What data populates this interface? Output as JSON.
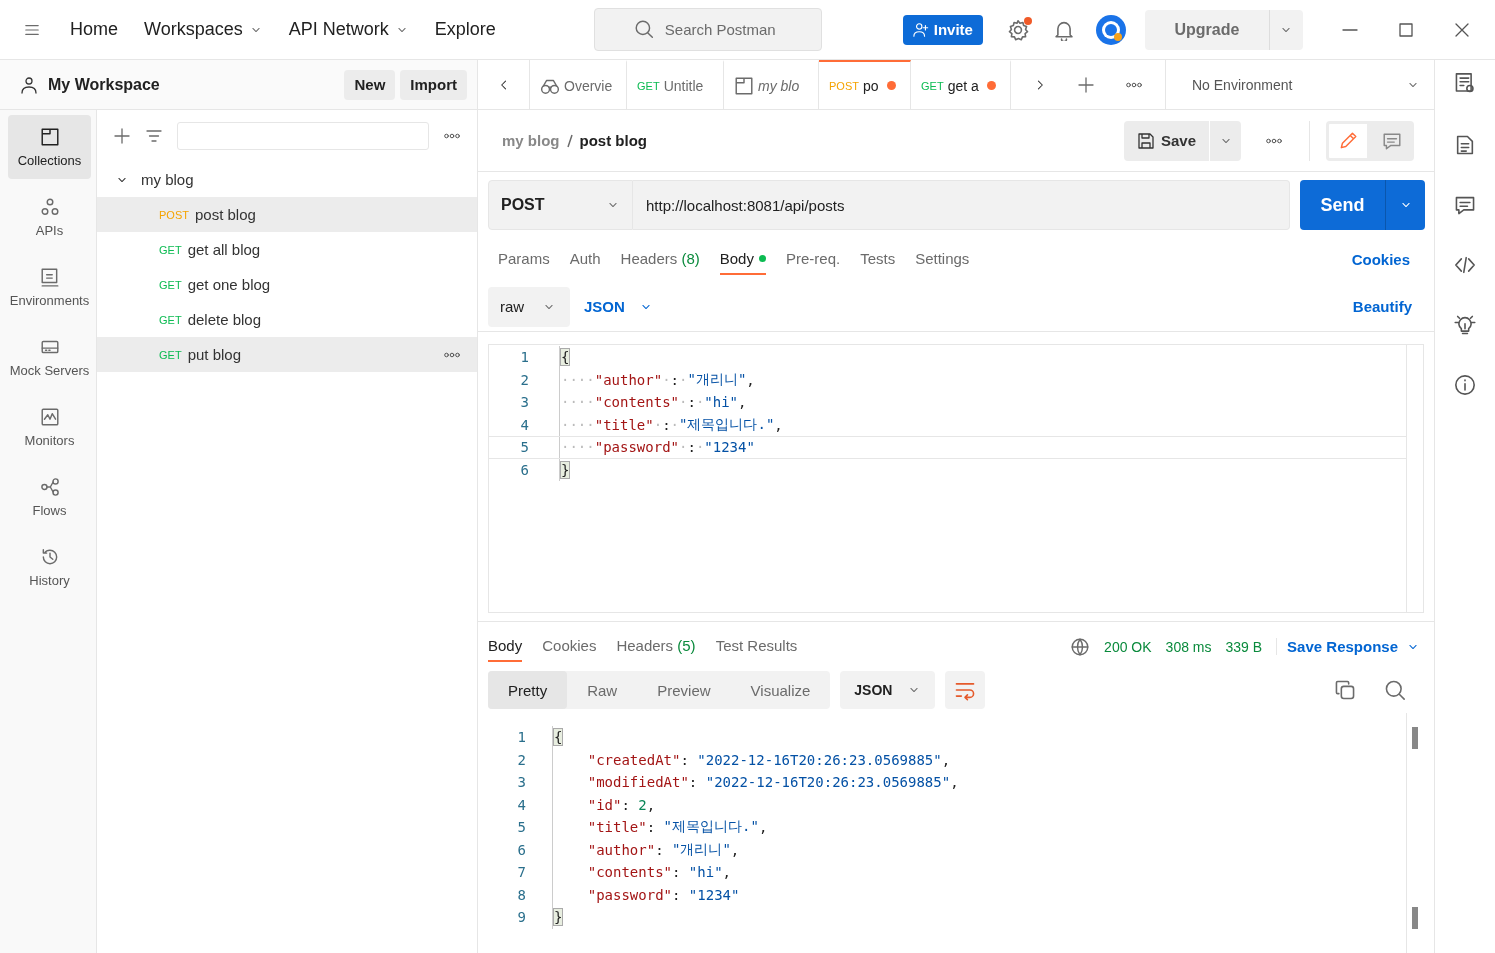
{
  "top_nav": {
    "items": [
      {
        "label": "Home",
        "caret": false
      },
      {
        "label": "Workspaces",
        "caret": true
      },
      {
        "label": "API Network",
        "caret": true
      },
      {
        "label": "Explore",
        "caret": false
      }
    ],
    "search": {
      "placeholder": "Search Postman"
    },
    "invite": "Invite",
    "settings_badge": true,
    "upgrade": "Upgrade"
  },
  "workspace": {
    "title": "My Workspace",
    "buttons": [
      "New",
      "Import"
    ]
  },
  "rail": [
    {
      "label": "Collections",
      "selected": true
    },
    {
      "label": "APIs",
      "selected": false
    },
    {
      "label": "Environments",
      "selected": false
    },
    {
      "label": "Mock Servers",
      "selected": false
    },
    {
      "label": "Monitors",
      "selected": false
    },
    {
      "label": "Flows",
      "selected": false
    },
    {
      "label": "History",
      "selected": false
    }
  ],
  "tree": {
    "name": "my blog",
    "expanded": true,
    "children": [
      {
        "method": "POST",
        "name": "post blog",
        "selected": true,
        "hovered": false
      },
      {
        "method": "GET",
        "name": "get all blog",
        "selected": false,
        "hovered": false
      },
      {
        "method": "GET",
        "name": "get one blog",
        "selected": false,
        "hovered": false
      },
      {
        "method": "GET",
        "name": "delete blog",
        "selected": false,
        "hovered": false
      },
      {
        "method": "GET",
        "name": "put blog",
        "selected": false,
        "hovered": true
      }
    ]
  },
  "tabs": [
    {
      "kind": "overview",
      "title": "Overvie",
      "selected": false,
      "unsaved": false
    },
    {
      "kind": "request",
      "method": "GET",
      "title": "Untitle",
      "selected": false,
      "unsaved": false
    },
    {
      "kind": "collection",
      "title": "my blo",
      "selected": false,
      "unsaved": false
    },
    {
      "kind": "request",
      "method": "POST",
      "title": "po",
      "selected": true,
      "unsaved": true
    },
    {
      "kind": "request",
      "method": "GET",
      "title": "get a",
      "selected": false,
      "unsaved": true
    }
  ],
  "environment": "No Environment",
  "breadcrumb": {
    "parent": "my blog",
    "current": "post blog",
    "save": "Save"
  },
  "request": {
    "method": "POST",
    "url": "http://localhost:8081/api/posts",
    "send": "Send"
  },
  "request_tabs": [
    {
      "label": "Params",
      "selected": false,
      "dot": false
    },
    {
      "label": "Auth",
      "selected": false,
      "dot": false
    },
    {
      "label": "Headers",
      "count": "(8)",
      "selected": false,
      "dot": false
    },
    {
      "label": "Body",
      "selected": true,
      "dot": true
    },
    {
      "label": "Pre-req.",
      "selected": false,
      "dot": false
    },
    {
      "label": "Tests",
      "selected": false,
      "dot": false
    },
    {
      "label": "Settings",
      "selected": false,
      "dot": false
    }
  ],
  "cookies_link": "Cookies",
  "body_options": {
    "mode": "raw",
    "format": "JSON",
    "beautify": "Beautify"
  },
  "request_body": [
    {
      "number": "1",
      "tokens": [
        {
          "kind": "bracket",
          "text": "{"
        }
      ]
    },
    {
      "number": "2",
      "tokens": [
        {
          "kind": "ws",
          "text": "····"
        },
        {
          "kind": "key",
          "text": "\"author\""
        },
        {
          "kind": "ws",
          "text": "·"
        },
        {
          "kind": "punct",
          "text": ":"
        },
        {
          "kind": "ws",
          "text": "·"
        },
        {
          "kind": "string",
          "text": "\"개리니\""
        },
        {
          "kind": "punct",
          "text": ","
        }
      ]
    },
    {
      "number": "3",
      "tokens": [
        {
          "kind": "ws",
          "text": "····"
        },
        {
          "kind": "key",
          "text": "\"contents\""
        },
        {
          "kind": "ws",
          "text": "·"
        },
        {
          "kind": "punct",
          "text": ":"
        },
        {
          "kind": "ws",
          "text": "·"
        },
        {
          "kind": "string",
          "text": "\"hi\""
        },
        {
          "kind": "punct",
          "text": ","
        }
      ]
    },
    {
      "number": "4",
      "tokens": [
        {
          "kind": "ws",
          "text": "····"
        },
        {
          "kind": "key",
          "text": "\"title\""
        },
        {
          "kind": "ws",
          "text": "·"
        },
        {
          "kind": "punct",
          "text": ":"
        },
        {
          "kind": "ws",
          "text": "·"
        },
        {
          "kind": "string",
          "text": "\"제목입니다.\""
        },
        {
          "kind": "punct",
          "text": ","
        }
      ]
    },
    {
      "number": "5",
      "current": true,
      "tokens": [
        {
          "kind": "ws",
          "text": "····"
        },
        {
          "kind": "key",
          "text": "\"password\""
        },
        {
          "kind": "ws",
          "text": "·"
        },
        {
          "kind": "punct",
          "text": ":"
        },
        {
          "kind": "ws",
          "text": "·"
        },
        {
          "kind": "string",
          "text": "\"1234\""
        }
      ]
    },
    {
      "number": "6",
      "tokens": [
        {
          "kind": "bracket",
          "text": "}"
        }
      ]
    }
  ],
  "response_tabs": [
    {
      "label": "Body",
      "selected": true
    },
    {
      "label": "Cookies",
      "selected": false
    },
    {
      "label": "Headers",
      "count": "(5)",
      "selected": false
    },
    {
      "label": "Test Results",
      "selected": false
    }
  ],
  "response_status": {
    "status": "200 OK",
    "time": "308 ms",
    "size": "339 B",
    "save": "Save Response"
  },
  "view_modes": [
    {
      "label": "Pretty",
      "selected": true
    },
    {
      "label": "Raw",
      "selected": false
    },
    {
      "label": "Preview",
      "selected": false
    },
    {
      "label": "Visualize",
      "selected": false
    }
  ],
  "response_format": "JSON",
  "response_body": [
    {
      "number": "1",
      "tokens": [
        {
          "kind": "bracket",
          "text": "{"
        }
      ]
    },
    {
      "number": "2",
      "tokens": [
        {
          "kind": "key",
          "text": "\"createdAt\""
        },
        {
          "kind": "punct",
          "text": ": "
        },
        {
          "kind": "string",
          "text": "\"2022-12-16T20:26:23.0569885\""
        },
        {
          "kind": "punct",
          "text": ","
        }
      ]
    },
    {
      "number": "3",
      "tokens": [
        {
          "kind": "key",
          "text": "\"modifiedAt\""
        },
        {
          "kind": "punct",
          "text": ": "
        },
        {
          "kind": "string",
          "text": "\"2022-12-16T20:26:23.0569885\""
        },
        {
          "kind": "punct",
          "text": ","
        }
      ]
    },
    {
      "number": "4",
      "tokens": [
        {
          "kind": "key",
          "text": "\"id\""
        },
        {
          "kind": "punct",
          "text": ": "
        },
        {
          "kind": "number",
          "text": "2"
        },
        {
          "kind": "punct",
          "text": ","
        }
      ]
    },
    {
      "number": "5",
      "tokens": [
        {
          "kind": "key",
          "text": "\"title\""
        },
        {
          "kind": "punct",
          "text": ": "
        },
        {
          "kind": "string",
          "text": "\"제목입니다.\""
        },
        {
          "kind": "punct",
          "text": ","
        }
      ]
    },
    {
      "number": "6",
      "tokens": [
        {
          "kind": "key",
          "text": "\"author\""
        },
        {
          "kind": "punct",
          "text": ": "
        },
        {
          "kind": "string",
          "text": "\"개리니\""
        },
        {
          "kind": "punct",
          "text": ","
        }
      ]
    },
    {
      "number": "7",
      "tokens": [
        {
          "kind": "key",
          "text": "\"contents\""
        },
        {
          "kind": "punct",
          "text": ": "
        },
        {
          "kind": "string",
          "text": "\"hi\""
        },
        {
          "kind": "punct",
          "text": ","
        }
      ]
    },
    {
      "number": "8",
      "tokens": [
        {
          "kind": "key",
          "text": "\"password\""
        },
        {
          "kind": "punct",
          "text": ": "
        },
        {
          "kind": "string",
          "text": "\"1234\""
        }
      ]
    },
    {
      "number": "9",
      "tokens": [
        {
          "kind": "bracket",
          "text": "}"
        }
      ]
    }
  ]
}
